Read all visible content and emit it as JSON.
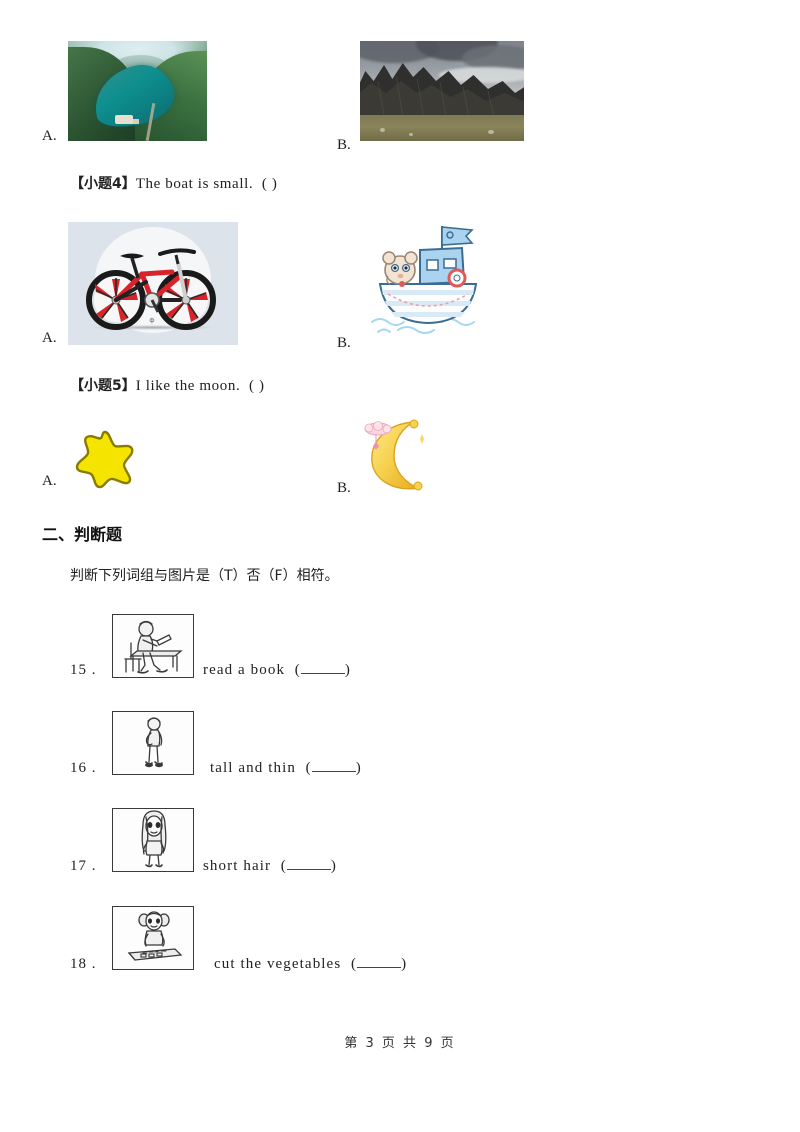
{
  "page": {
    "footer": "第 3 页 共 9 页",
    "current_page": "3",
    "total_pages": "9"
  },
  "questions_part1": [
    {
      "id": "q3-options",
      "options": [
        {
          "label": "A.",
          "image": "green-lake-valley-photo"
        },
        {
          "label": "B.",
          "image": "dark-mountain-ridge-photo"
        }
      ]
    },
    {
      "id": "q4",
      "marker": "【小题4】",
      "text": "The boat is small.",
      "answer_bracket": "(      )",
      "options": [
        {
          "label": "A.",
          "image": "red-mountain-bicycle"
        },
        {
          "label": "B.",
          "image": "cartoon-boat-with-bear"
        }
      ]
    },
    {
      "id": "q5",
      "marker": "【小题5】",
      "text": "I like the moon.",
      "answer_bracket": "(      )",
      "options": [
        {
          "label": "A.",
          "image": "yellow-star"
        },
        {
          "label": "B.",
          "image": "crescent-moon"
        }
      ]
    }
  ],
  "section2": {
    "heading": "二、判断题",
    "instruction": "判断下列词组与图片是（T）否（F）相符。",
    "items": [
      {
        "number": "15 .",
        "phrase": "read a book",
        "bracket_open": "(",
        "blank": "",
        "bracket_close": ")",
        "image": "person-reading-at-desk"
      },
      {
        "number": "16 .",
        "phrase": "tall and thin",
        "bracket_open": "(",
        "blank": "",
        "bracket_close": ")",
        "image": "tall-thin-person"
      },
      {
        "number": "17 .",
        "phrase": "short hair",
        "bracket_open": "(",
        "blank": "",
        "bracket_close": ")",
        "image": "girl-with-long-hair"
      },
      {
        "number": "18 .",
        "phrase": "cut the vegetables",
        "bracket_open": "(",
        "blank": "",
        "bracket_close": ")",
        "image": "girl-cutting-vegetables"
      }
    ]
  },
  "colors": {
    "star_fill": "#f5e400",
    "star_stroke": "#8a7a00",
    "moon_fill": "#f6cf45",
    "boat_blue": "#a9d3ef",
    "bike_red": "#d9232b",
    "text": "#222222"
  }
}
